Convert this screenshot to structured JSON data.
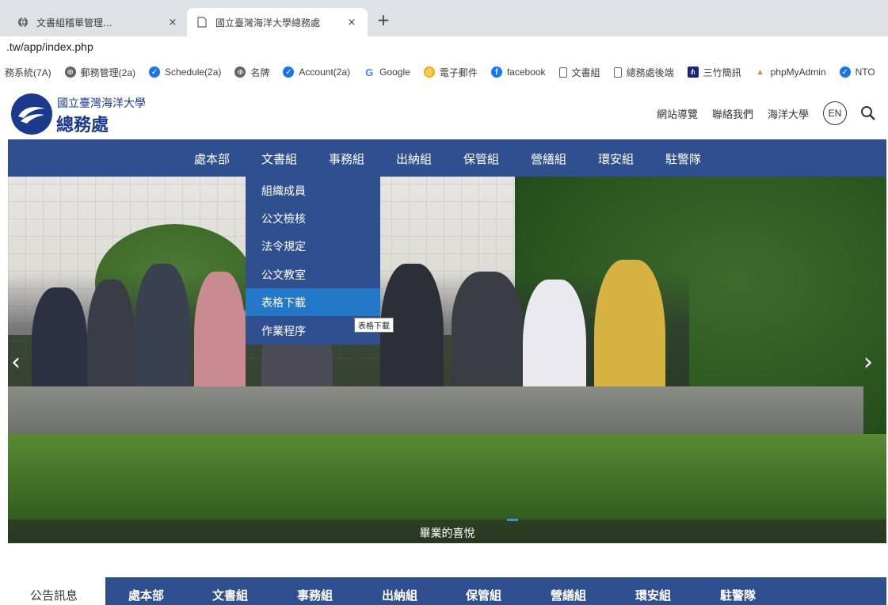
{
  "browser": {
    "tabs": [
      {
        "title": "文書組稽單管理...",
        "close": "×",
        "active": false
      },
      {
        "title": "國立臺灣海洋大學總務處",
        "close": "×",
        "active": true
      }
    ],
    "new_tab": "+",
    "url": ".tw/app/index.php",
    "bookmarks": [
      {
        "label": "務系統(7A)",
        "icon": "none"
      },
      {
        "label": "郵務管理(2a)",
        "icon": "globe-icon"
      },
      {
        "label": "Schedule(2a)",
        "icon": "check-icon"
      },
      {
        "label": "名牌",
        "icon": "globe-icon"
      },
      {
        "label": "Account(2a)",
        "icon": "check-icon"
      },
      {
        "label": "Google",
        "icon": "google-icon"
      },
      {
        "label": "電子郵件",
        "icon": "mail-icon"
      },
      {
        "label": "facebook",
        "icon": "facebook-icon"
      },
      {
        "label": "文書組",
        "icon": "page-icon"
      },
      {
        "label": "總務處後端",
        "icon": "page-icon"
      },
      {
        "label": "三竹簡訊",
        "icon": "tree-icon"
      },
      {
        "label": "phpMyAdmin",
        "icon": "phpmyadmin-icon"
      },
      {
        "label": "NTO",
        "icon": "check-icon"
      }
    ]
  },
  "header": {
    "university": "國立臺灣海洋大學",
    "office": "總務處",
    "links": [
      "網站導覽",
      "聯絡我們",
      "海洋大學"
    ],
    "lang_button": "EN"
  },
  "nav": {
    "items": [
      "處本部",
      "文書組",
      "事務組",
      "出納組",
      "保管組",
      "營繕組",
      "環安組",
      "駐警隊"
    ],
    "active_index": 1
  },
  "dropdown": {
    "items": [
      "組織成員",
      "公文檢核",
      "法令規定",
      "公文教室",
      "表格下載",
      "作業程序"
    ],
    "hover_index": 4,
    "tooltip": "表格下載"
  },
  "hero": {
    "caption": "畢業的喜悅",
    "prev_arrow": "‹",
    "next_arrow": "›"
  },
  "news": {
    "label": "公告訊息",
    "tabs": [
      "處本部",
      "文書組",
      "事務組",
      "出納組",
      "保管組",
      "營繕組",
      "環安組",
      "駐警隊"
    ]
  },
  "colors": {
    "nav_blue": "#2f4f8f",
    "hover_blue": "#2378c7",
    "logo_blue": "#1b3a8c"
  }
}
